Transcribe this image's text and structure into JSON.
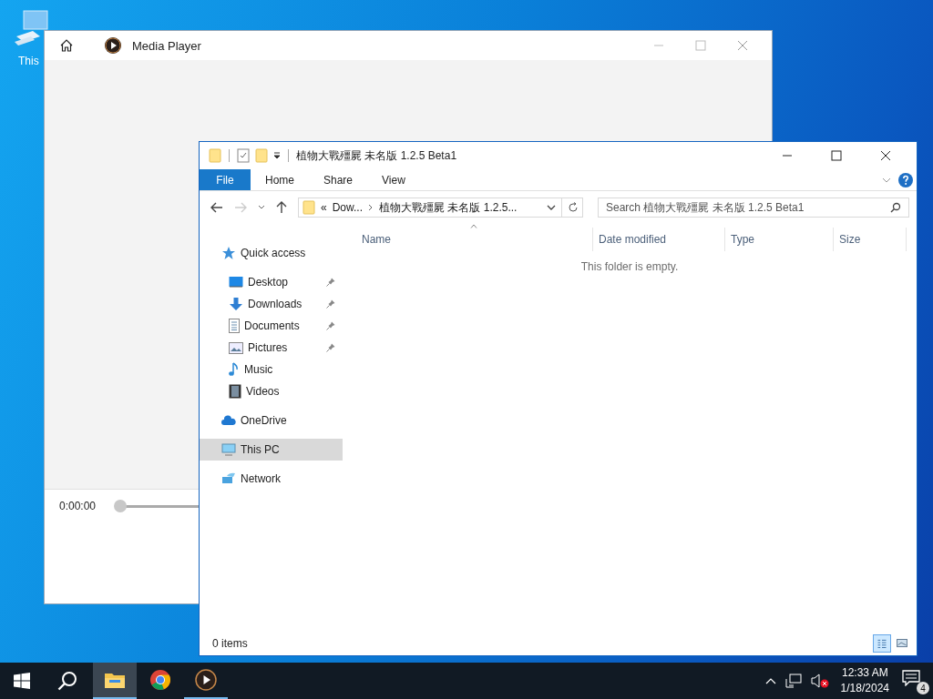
{
  "desktop": {
    "icons": [
      {
        "label": "This"
      }
    ]
  },
  "media_player": {
    "title": "Media Player",
    "time": "0:00:00",
    "seek": {
      "level": 0
    }
  },
  "explorer": {
    "title": "植物大戰殭屍 未名版 1.2.5 Beta1",
    "ribbon_tabs": [
      {
        "label": "File",
        "selected": true
      },
      {
        "label": "Home",
        "selected": false
      },
      {
        "label": "Share",
        "selected": false
      },
      {
        "label": "View",
        "selected": false
      }
    ],
    "address": {
      "overflow": "«",
      "crumbs": [
        "Dow...",
        "植物大戰殭屍 未名版 1.2.5..."
      ]
    },
    "search": {
      "placeholder": "Search 植物大戰殭屍 未名版 1.2.5 Beta1"
    },
    "nav": [
      {
        "label": "Quick access",
        "kind": "star",
        "selected": false,
        "children": [
          {
            "label": "Desktop",
            "kind": "desktop",
            "pinned": true,
            "selected": false
          },
          {
            "label": "Downloads",
            "kind": "download",
            "pinned": true,
            "selected": false
          },
          {
            "label": "Documents",
            "kind": "document",
            "pinned": true,
            "selected": false
          },
          {
            "label": "Pictures",
            "kind": "picture",
            "pinned": true,
            "selected": false
          },
          {
            "label": "Music",
            "kind": "music",
            "pinned": false,
            "selected": false
          },
          {
            "label": "Videos",
            "kind": "video",
            "pinned": false,
            "selected": false
          }
        ]
      },
      {
        "label": "OneDrive",
        "kind": "cloud",
        "selected": false
      },
      {
        "label": "This PC",
        "kind": "computer",
        "selected": true
      },
      {
        "label": "Network",
        "kind": "network",
        "selected": false
      }
    ],
    "columns": [
      {
        "label": "Name",
        "sorted": true
      },
      {
        "label": "Date modified",
        "sorted": false
      },
      {
        "label": "Type",
        "sorted": false
      },
      {
        "label": "Size",
        "sorted": false
      }
    ],
    "empty_message": "This folder is empty.",
    "status": "0 items",
    "views": [
      {
        "kind": "details",
        "selected": true
      },
      {
        "kind": "large",
        "selected": false
      }
    ]
  },
  "taskbar": {
    "apps": [
      {
        "kind": "files",
        "active": true,
        "running": true
      },
      {
        "kind": "browser",
        "active": false,
        "running": false
      },
      {
        "kind": "player",
        "active": false,
        "running": true
      }
    ],
    "time": "12:33 AM",
    "date": "1/18/2024",
    "notifications": "4"
  }
}
